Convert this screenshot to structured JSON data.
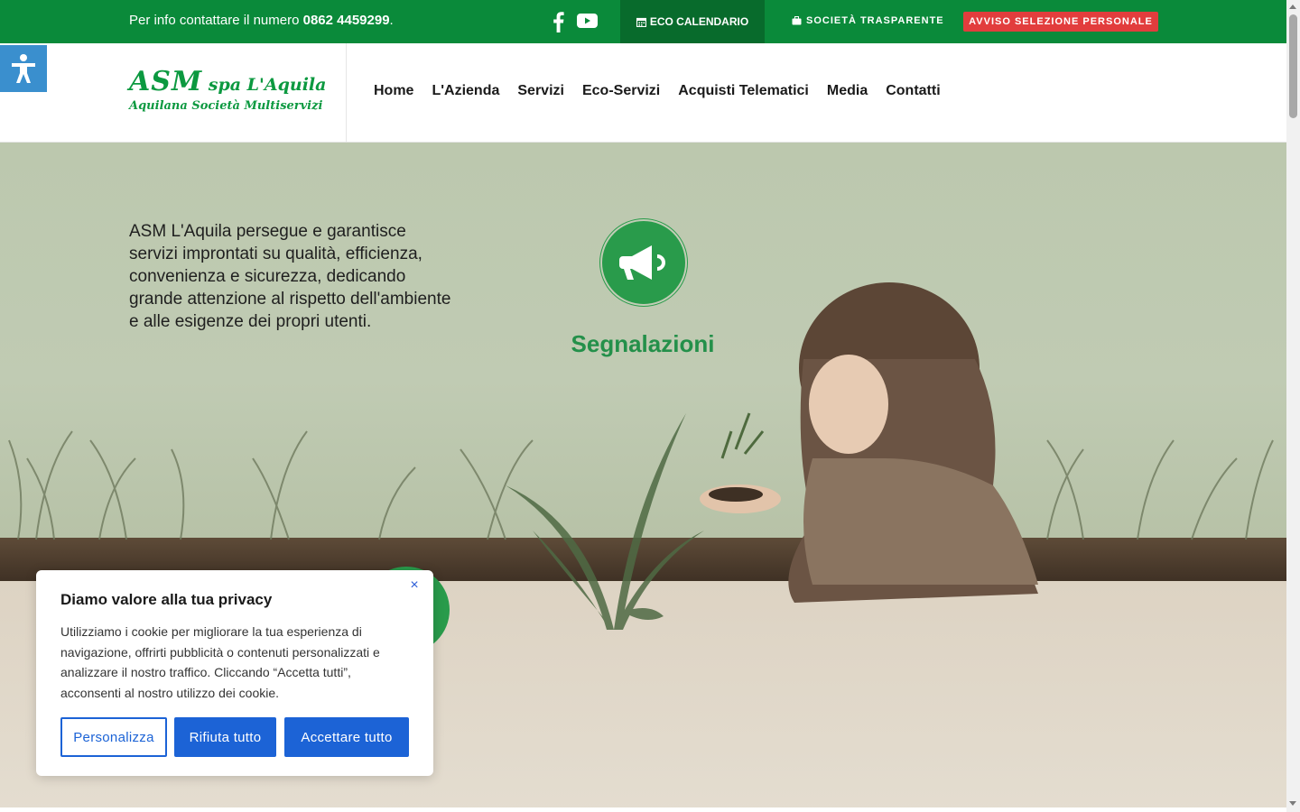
{
  "topbar": {
    "info_prefix": "Per info contattare il numero ",
    "phone": "0862 4459299",
    "info_suffix": ".",
    "eco_calendario": "ECO CALENDARIO",
    "societa_trasparente": "SOCIETÀ TRASPARENTE",
    "avviso": "AVVISO SELEZIONE PERSONALE"
  },
  "logo": {
    "line1_main": "ASM",
    "line1_rest": " spa L'Aquila",
    "line2": "Aquilana Società Multiservizi"
  },
  "nav": {
    "items": [
      "Home",
      "L'Azienda",
      "Servizi",
      "Eco-Servizi",
      "Acquisti Telematici",
      "Media",
      "Contatti"
    ]
  },
  "hero": {
    "text": "ASM L'Aquila persegue e garantisce servizi improntati su qualità, efficienza, convenienza e sicurezza, dedicando grande attenzione al rispetto dell'ambiente e alle esigenze dei propri utenti.",
    "segnalazioni": "Segnalazioni"
  },
  "cookie": {
    "title": "Diamo valore alla tua privacy",
    "body": "Utilizziamo i cookie per migliorare la tua esperienza di navigazione, offrirti pubblicità o contenuti personalizzati e analizzare il nostro traffico. Cliccando “Accetta tutti”, acconsenti al nostro utilizzo dei cookie.",
    "btn_customize": "Personalizza",
    "btn_reject": "Rifiuta tutto",
    "btn_accept": "Accettare tutto",
    "close": "×"
  },
  "colors": {
    "brand_green": "#0a8a3a",
    "dark_green": "#086b2c",
    "alert_red": "#e23d3d",
    "button_blue": "#1c63d6",
    "access_blue": "#3a8fce"
  },
  "icons": [
    "facebook-icon",
    "youtube-icon",
    "calendar-icon",
    "briefcase-icon",
    "accessibility-icon",
    "megaphone-icon",
    "close-icon"
  ]
}
